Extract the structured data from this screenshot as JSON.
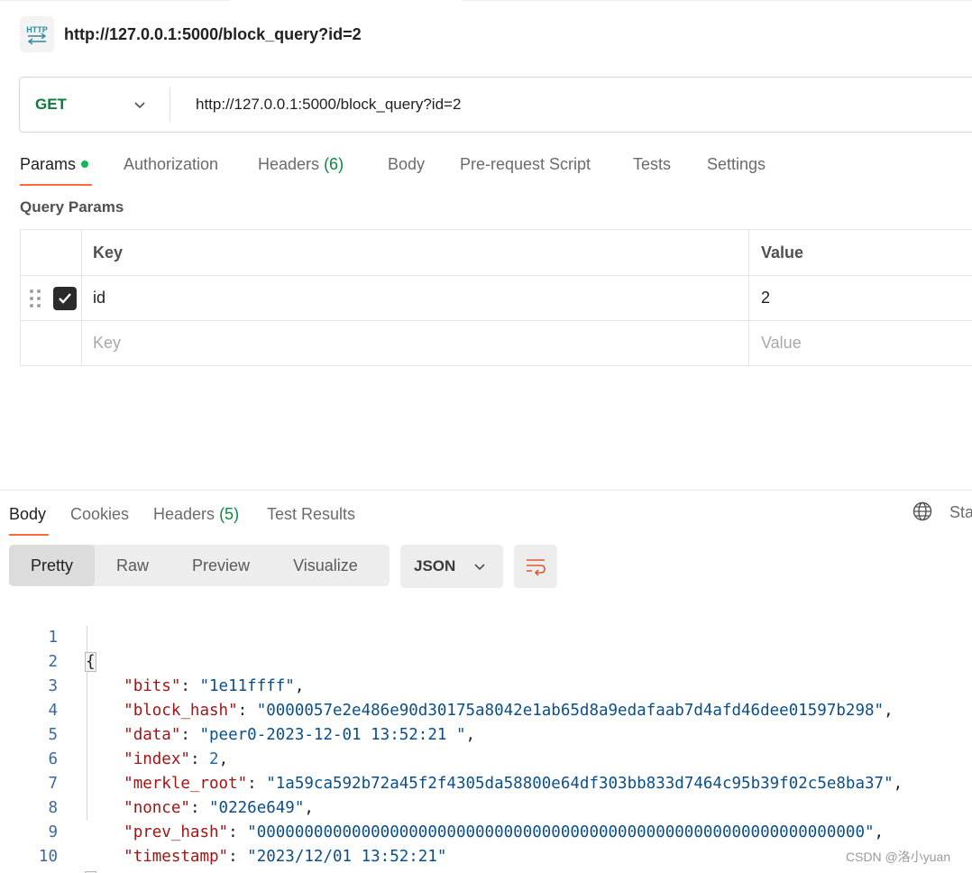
{
  "request": {
    "title": "http://127.0.0.1:5000/block_query?id=2",
    "method": "GET",
    "url": "http://127.0.0.1:5000/block_query?id=2"
  },
  "request_tabs": [
    {
      "label": "Params",
      "active": true
    },
    {
      "label": "Authorization"
    },
    {
      "label": "Headers",
      "count": "(6)"
    },
    {
      "label": "Body"
    },
    {
      "label": "Pre-request Script"
    },
    {
      "label": "Tests"
    },
    {
      "label": "Settings"
    }
  ],
  "query_params": {
    "section_label": "Query Params",
    "headers": {
      "key": "Key",
      "value": "Value"
    },
    "rows": [
      {
        "key": "id",
        "value": "2",
        "checked": true
      }
    ],
    "placeholder": {
      "key": "Key",
      "value": "Value"
    }
  },
  "response": {
    "tabs": [
      {
        "label": "Body",
        "active": true
      },
      {
        "label": "Cookies"
      },
      {
        "label": "Headers",
        "count": "(5)"
      },
      {
        "label": "Test Results"
      }
    ],
    "status_cut": "Sta",
    "view_modes": [
      "Pretty",
      "Raw",
      "Preview",
      "Visualize"
    ],
    "active_view": "Pretty",
    "format": "JSON",
    "lines": [
      {
        "n": "1"
      },
      {
        "n": "2",
        "key": "bits",
        "val": "\"1e11ffff\"",
        "type": "str"
      },
      {
        "n": "3",
        "key": "block_hash",
        "val": "\"0000057e2e486e90d30175a8042e1ab65d8a9edafaab7d4afd46dee01597b298\"",
        "type": "str"
      },
      {
        "n": "4",
        "key": "data",
        "val": "\"peer0-2023-12-01 13:52:21 \"",
        "type": "str"
      },
      {
        "n": "5",
        "key": "index",
        "val": "2",
        "type": "num"
      },
      {
        "n": "6",
        "key": "merkle_root",
        "val": "\"1a59ca592b72a45f2f4305da58800e64df303bb833d7464c95b39f02c5e8ba37\"",
        "type": "str"
      },
      {
        "n": "7",
        "key": "nonce",
        "val": "\"0226e649\"",
        "type": "str"
      },
      {
        "n": "8",
        "key": "prev_hash",
        "val": "\"0000000000000000000000000000000000000000000000000000000000000000\"",
        "type": "str"
      },
      {
        "n": "9",
        "key": "timestamp",
        "val": "\"2023/12/01 13:52:21\"",
        "type": "str"
      },
      {
        "n": "10"
      }
    ],
    "open_brace": "{",
    "close_brace": "}"
  },
  "watermark": "CSDN @洛小yuan",
  "colors": {
    "accent": "#ff6c37",
    "get_method": "#0b7a3e",
    "dot": "#0cbb52"
  }
}
